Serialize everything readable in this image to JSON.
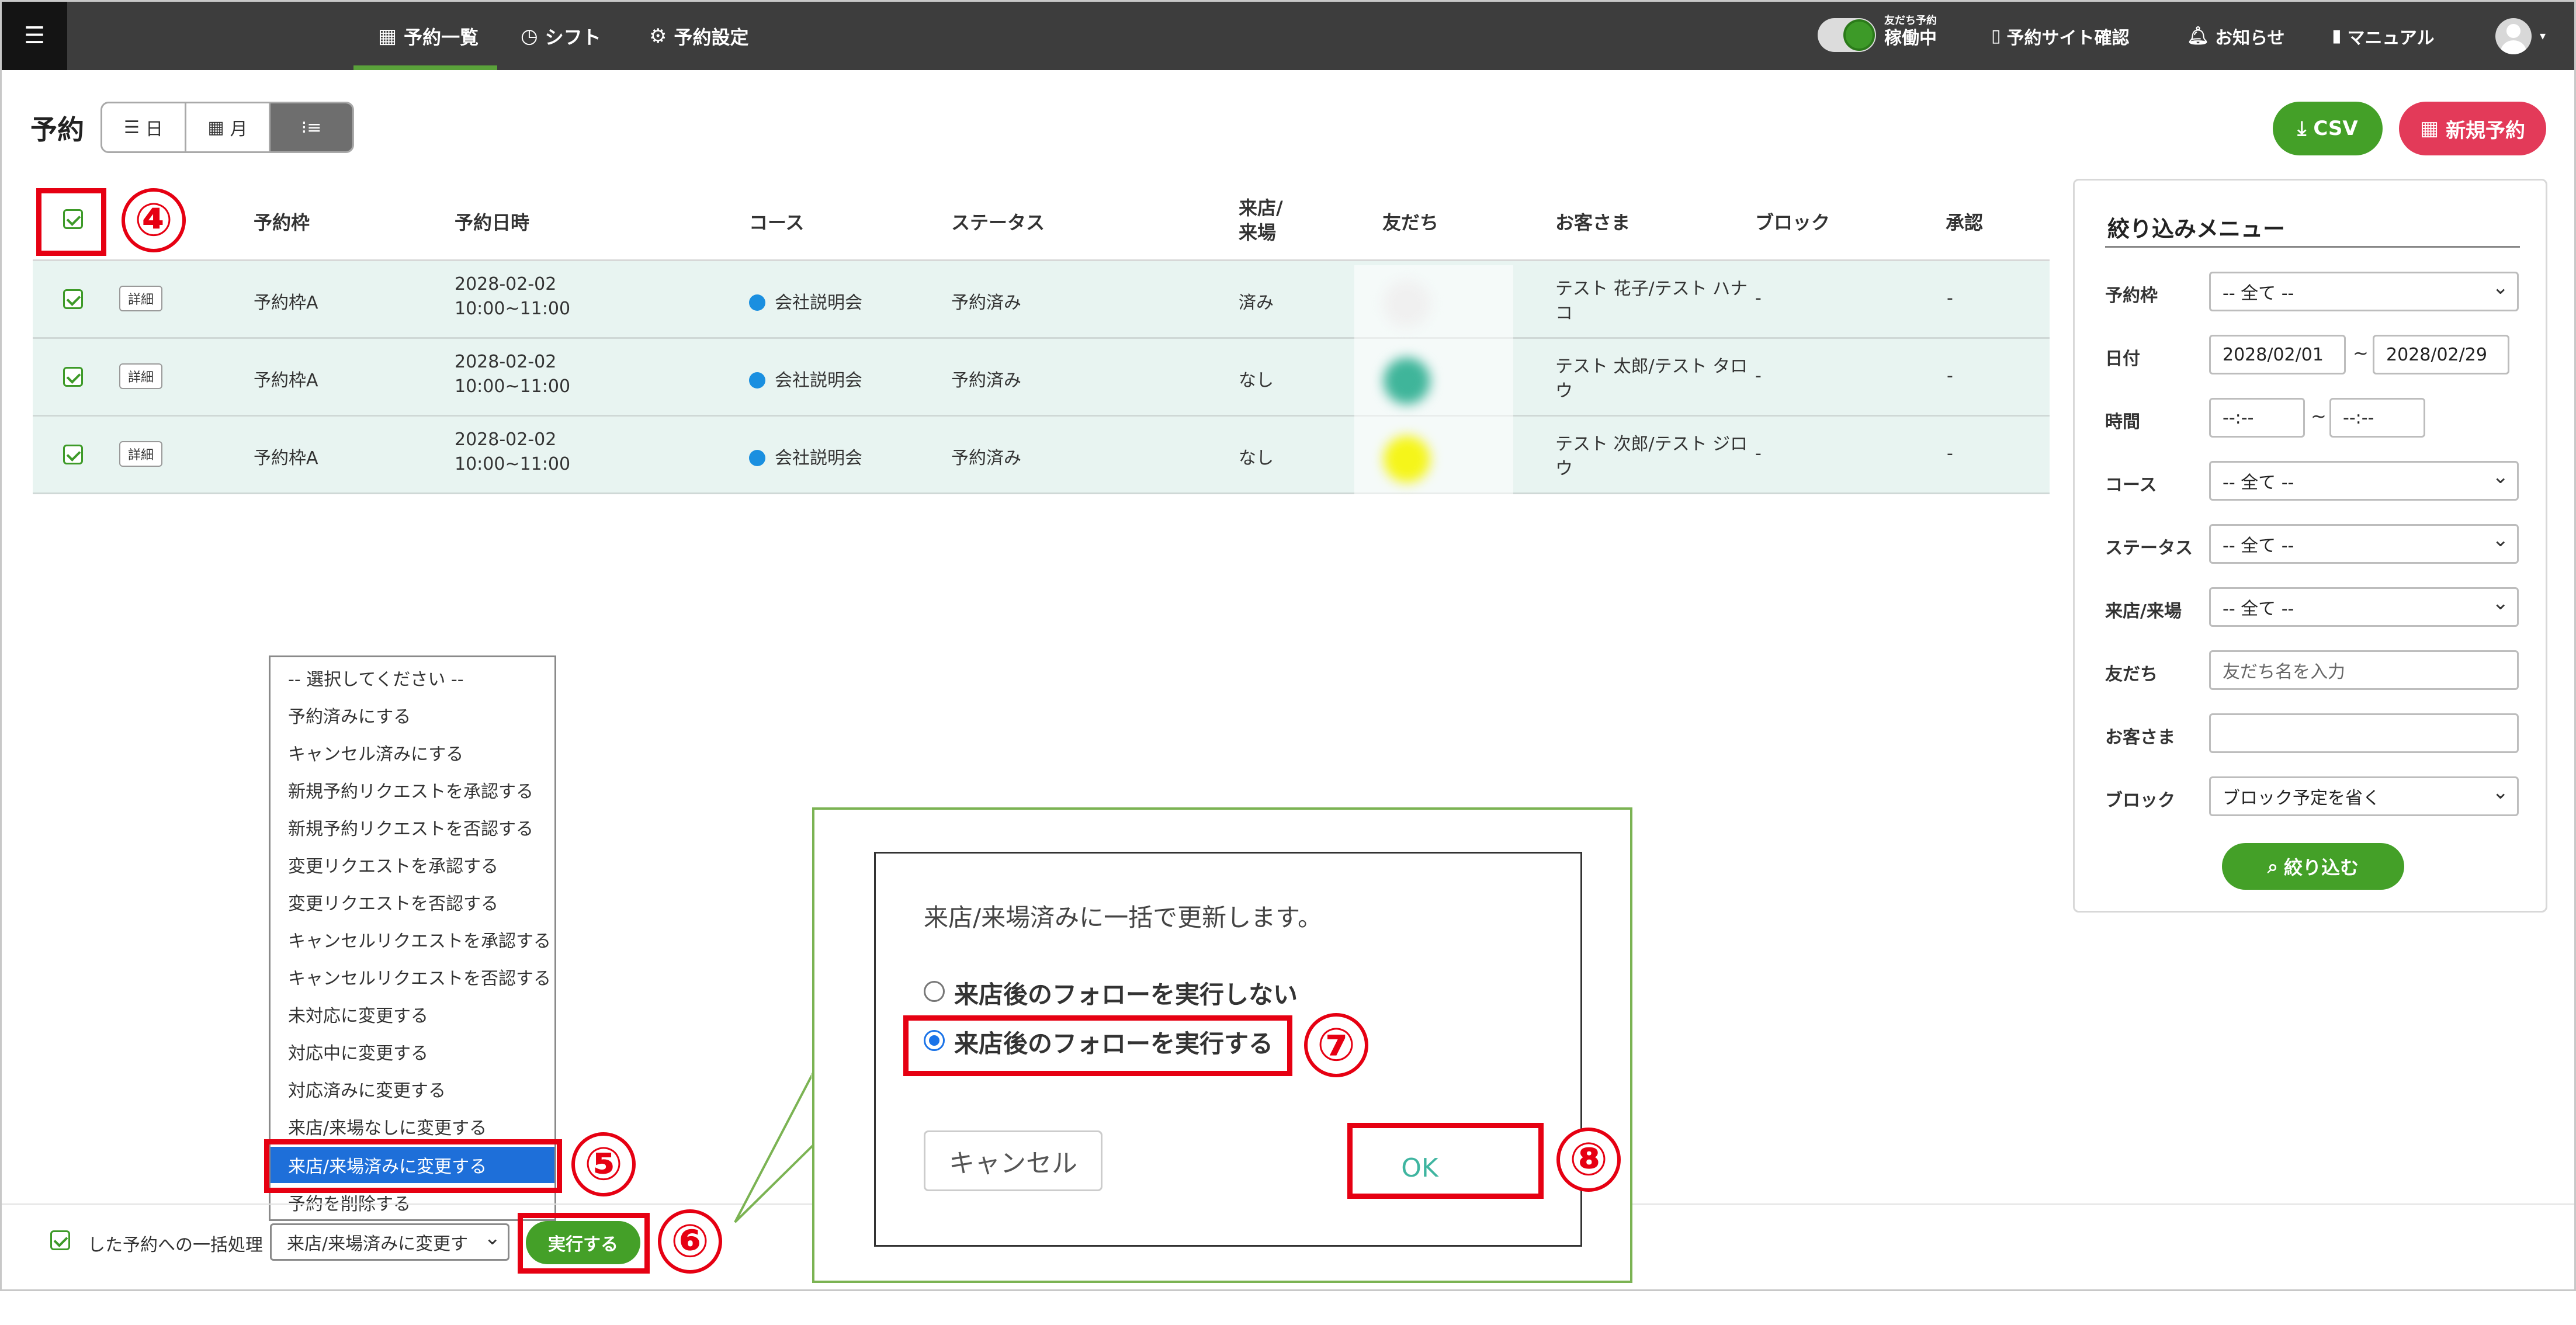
{
  "nav": {
    "menu_icon": "menu-icon",
    "items": [
      {
        "label": "予約一覧",
        "icon": "calendar-icon"
      },
      {
        "label": "シフト",
        "icon": "clock-icon"
      },
      {
        "label": "予約設定",
        "icon": "gear-icon"
      }
    ],
    "toggle_small": "友だち予約",
    "toggle_label": "稼働中",
    "right": [
      {
        "label": "予約サイト確認",
        "icon": "phone-icon"
      },
      {
        "label": "お知らせ",
        "icon": "bell-icon"
      },
      {
        "label": "マニュアル",
        "icon": "book-icon"
      }
    ]
  },
  "header": {
    "title": "予約",
    "views": [
      {
        "label": "日",
        "icon": "list-icon"
      },
      {
        "label": "月",
        "icon": "calendar-icon"
      },
      {
        "label": "",
        "icon": "list-bullets-icon"
      }
    ],
    "csv_label": "CSV",
    "new_label": "新規予約"
  },
  "table": {
    "columns": [
      "予約枠",
      "予約日時",
      "コース",
      "ステータス",
      "来店/\n来場",
      "友だち",
      "お客さま",
      "ブロック",
      "承認"
    ],
    "visit_col_line1": "来店/",
    "visit_col_line2": "来場",
    "detail_label": "詳細",
    "rows": [
      {
        "slot": "予約枠A",
        "date": "2028-02-02",
        "time": "10:00~11:00",
        "course": "会社説明会",
        "status": "予約済み",
        "visit": "済み",
        "customer_l1": "テスト 花子/テスト ハナ",
        "customer_l2": "コ",
        "block": "-",
        "approval": "-",
        "friend_color": "#f2f2f2"
      },
      {
        "slot": "予約枠A",
        "date": "2028-02-02",
        "time": "10:00~11:00",
        "course": "会社説明会",
        "status": "予約済み",
        "visit": "なし",
        "customer_l1": "テスト 太郎/テスト タロ",
        "customer_l2": "ウ",
        "block": "-",
        "approval": "-",
        "friend_color": "#3fb59a"
      },
      {
        "slot": "予約枠A",
        "date": "2028-02-02",
        "time": "10:00~11:00",
        "course": "会社説明会",
        "status": "予約済み",
        "visit": "なし",
        "customer_l1": "テスト 次郎/テスト ジロ",
        "customer_l2": "ウ",
        "block": "-",
        "approval": "-",
        "friend_color": "#f5f51a"
      }
    ]
  },
  "filter": {
    "title": "絞り込みメニュー",
    "slot_label": "予約枠",
    "slot_value": "-- 全て --",
    "date_label": "日付",
    "date_from": "2028/02/01",
    "date_to": "2028/02/29",
    "time_label": "時間",
    "time_from": "--:--",
    "time_to": "--:--",
    "course_label": "コース",
    "course_value": "-- 全て --",
    "status_label": "ステータス",
    "status_value": "-- 全て --",
    "visit_label": "来店/来場",
    "visit_value": "-- 全て --",
    "friend_label": "友だち",
    "friend_placeholder": "友だち名を入力",
    "customer_label": "お客さま",
    "customer_value": "",
    "block_label": "ブロック",
    "block_value": "ブロック予定を省く",
    "search_label": "絞り込む",
    "tilde": "~"
  },
  "dropdown": {
    "options": [
      "-- 選択してください --",
      "予約済みにする",
      "キャンセル済みにする",
      "新規予約リクエストを承認する",
      "新規予約リクエストを否認する",
      "変更リクエストを承認する",
      "変更リクエストを否認する",
      "キャンセルリクエストを承認する",
      "キャンセルリクエストを否認する",
      "未対応に変更する",
      "対応中に変更する",
      "対応済みに変更する",
      "来店/来場なしに変更する",
      "来店/来場済みに変更する",
      "予約を削除する"
    ],
    "selected_index": 13
  },
  "bulk": {
    "label": "した予約への一括処理",
    "select_value": "来店/来場済みに変更す",
    "run_label": "実行する"
  },
  "dialog": {
    "message": "来店/来場済みに一括で更新します。",
    "option_no": "来店後のフォローを実行しない",
    "option_yes": "来店後のフォローを実行する",
    "cancel_label": "キャンセル",
    "ok_label": "OK"
  },
  "annotations": [
    "④",
    "⑤",
    "⑥",
    "⑦",
    "⑧"
  ],
  "colors": {
    "accent_green": "#44a028",
    "brand_red": "#e33a59",
    "annotation_red": "#e60012",
    "row_bg": "#e8f4f1"
  }
}
